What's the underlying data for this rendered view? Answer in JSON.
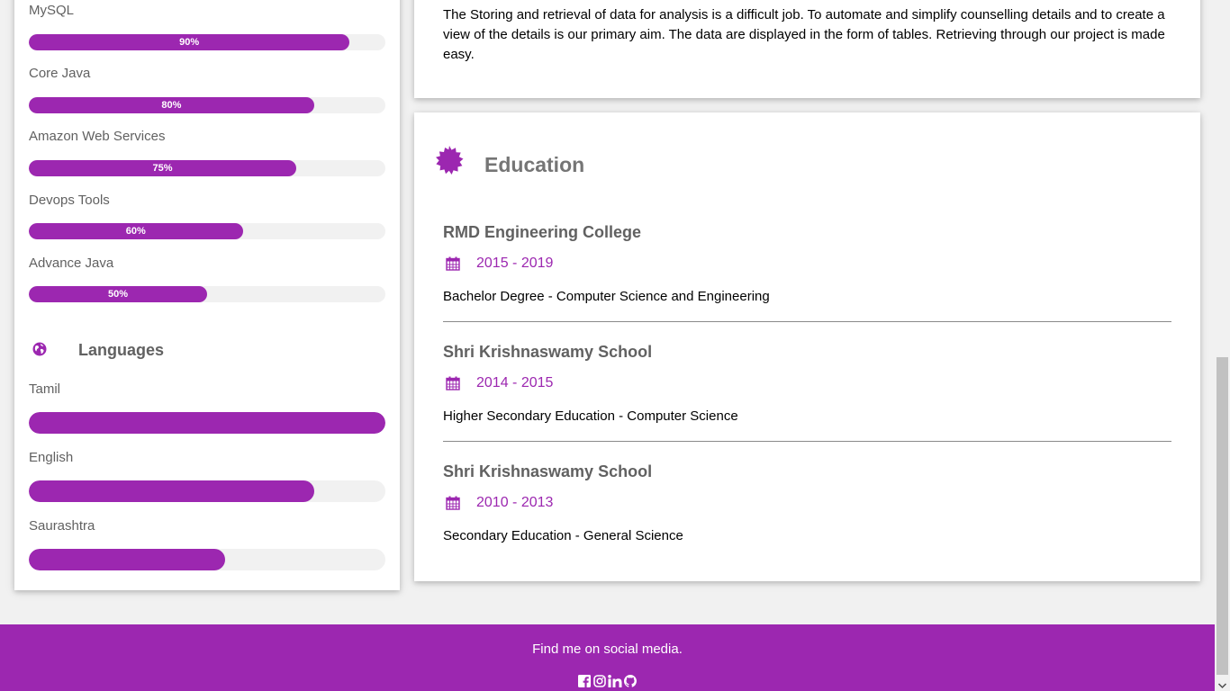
{
  "skills": [
    {
      "name": "MySQL",
      "percent_label": "90%",
      "level": 90
    },
    {
      "name": "Core Java",
      "percent_label": "80%",
      "level": 80
    },
    {
      "name": "Amazon Web Services",
      "percent_label": "75%",
      "level": 75
    },
    {
      "name": "Devops Tools",
      "percent_label": "60%",
      "level": 60
    },
    {
      "name": "Advance Java",
      "percent_label": "50%",
      "level": 50
    }
  ],
  "languages": {
    "title": "Languages",
    "icon": "globe-icon",
    "items": [
      {
        "name": "Tamil",
        "level": 100
      },
      {
        "name": "English",
        "level": 80
      },
      {
        "name": "Saurashtra",
        "level": 55
      }
    ]
  },
  "about": {
    "text": "The Storing and retrieval of data for analysis is a difficult job. To automate and simplify counselling details and to create a view of the details is our primary aim. The data are displayed in the form of tables. Retrieving through our project is made easy."
  },
  "education": {
    "title": "Education",
    "icon": "certificate-icon",
    "entries": [
      {
        "school": "RMD Engineering College",
        "dates": "2015 - 2019",
        "degree": "Bachelor Degree - Computer Science and Engineering"
      },
      {
        "school": "Shri Krishnaswamy School",
        "dates": "2014 - 2015",
        "degree": "Higher Secondary Education - Computer Science"
      },
      {
        "school": "Shri Krishnaswamy School",
        "dates": "2010 - 2013",
        "degree": "Secondary Education - General Science"
      }
    ]
  },
  "footer": {
    "text": "Find me on social media.",
    "social_icons": [
      "facebook-icon",
      "instagram-icon",
      "linkedin-icon",
      "github-icon"
    ]
  },
  "colors": {
    "accent": "#9c27b0",
    "bar_track": "#f1f1f1",
    "background": "#f1f1f1"
  }
}
